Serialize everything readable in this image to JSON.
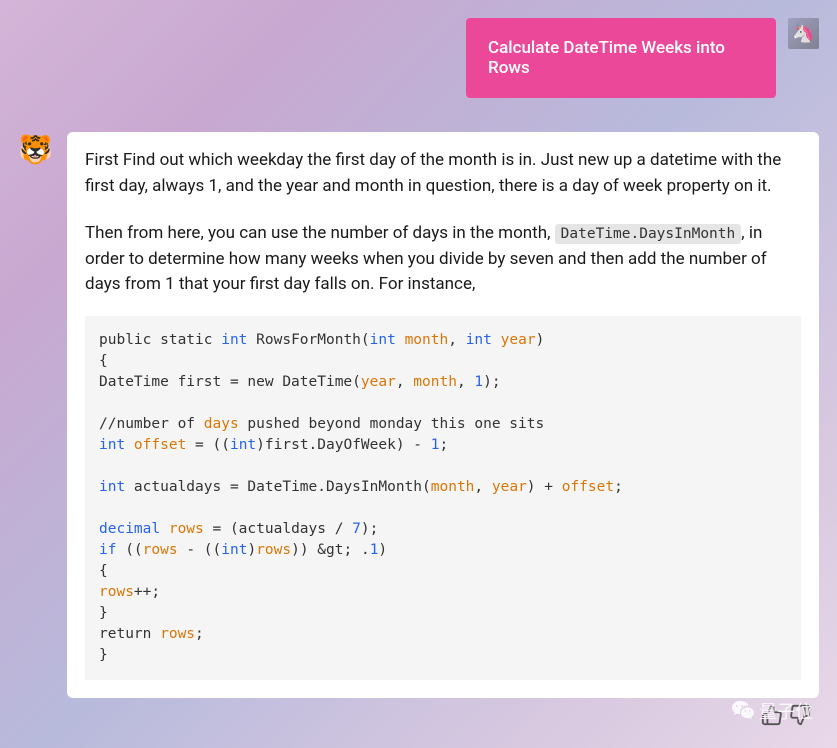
{
  "user": {
    "message": "Calculate DateTime Weeks into Rows",
    "avatar_emoji": "🦄"
  },
  "bot": {
    "avatar_emoji": "🐯",
    "paragraph1": "First Find out which weekday the first day of the month is in. Just new up a datetime with the first day, always 1, and the year and month in question, there is a day of week property on it.",
    "paragraph2_before": "Then from here, you can use the number of days in the month, ",
    "paragraph2_code": "DateTime.DaysInMonth",
    "paragraph2_after": ", in order to determine how many weeks when you divide by seven and then add the number of days from 1 that your first day falls on. For instance,",
    "code": {
      "l1_a": "public static ",
      "l1_b": "int",
      "l1_c": " RowsForMonth(",
      "l1_d": "int",
      "l1_e": " month",
      "l1_f": ", ",
      "l1_g": "int",
      "l1_h": " year",
      "l1_i": ")",
      "l2": "{",
      "l3_a": "DateTime first = new DateTime(",
      "l3_b": "year",
      "l3_c": ", ",
      "l3_d": "month",
      "l3_e": ", ",
      "l3_f": "1",
      "l3_g": ");",
      "l5_a": "//number of ",
      "l5_b": "days",
      "l5_c": " pushed beyond monday this one sits",
      "l6_a": "int",
      "l6_b": " offset",
      "l6_c": " = ((",
      "l6_d": "int",
      "l6_e": ")first.DayOfWeek) - ",
      "l6_f": "1",
      "l6_g": ";",
      "l8_a": "int",
      "l8_b": " actualdays = DateTime.DaysInMonth(",
      "l8_c": "month",
      "l8_d": ", ",
      "l8_e": "year",
      "l8_f": ") + ",
      "l8_g": "offset",
      "l8_h": ";",
      "l10_a": "decimal",
      "l10_b": " rows",
      "l10_c": " = (actualdays / ",
      "l10_d": "7",
      "l10_e": ");",
      "l11_a": "if",
      "l11_b": " ((",
      "l11_c": "rows",
      "l11_d": " - ((",
      "l11_e": "int",
      "l11_f": ")",
      "l11_g": "rows",
      "l11_h": ")) &gt; .",
      "l11_i": "1",
      "l11_j": ")",
      "l12": "{",
      "l13_a": "rows",
      "l13_b": "++;",
      "l14": "}",
      "l15_a": "return ",
      "l15_b": "rows",
      "l15_c": ";",
      "l16": "}"
    }
  },
  "watermark": {
    "text": "量子位"
  }
}
